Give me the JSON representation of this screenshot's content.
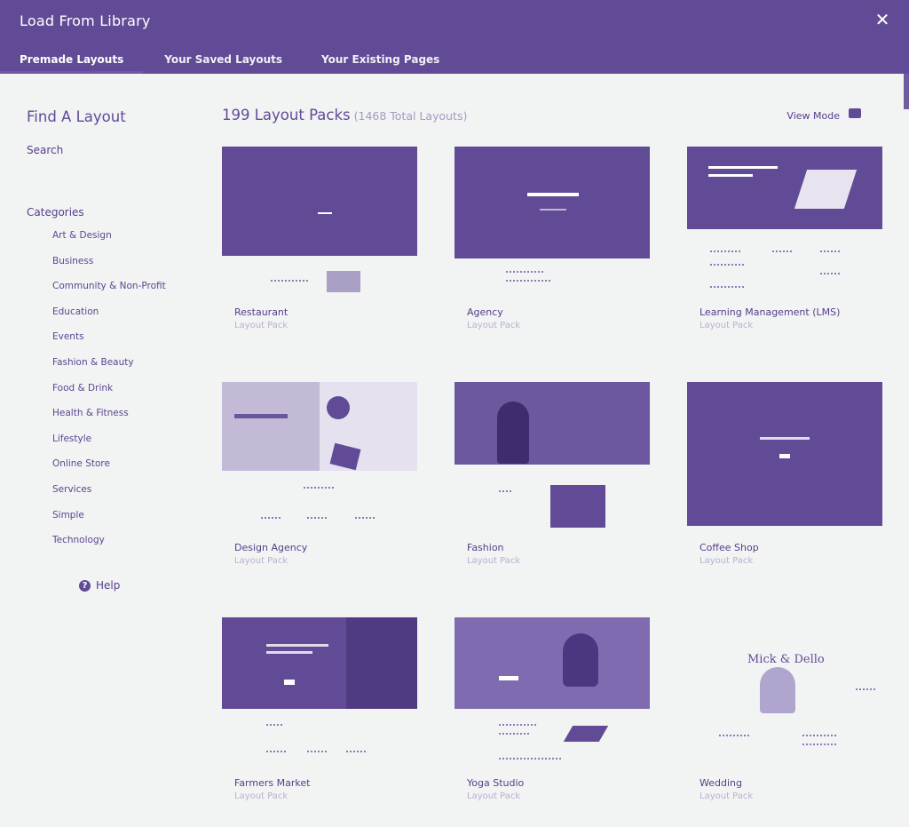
{
  "window": {
    "title": "Load From Library",
    "close_glyph": "✕"
  },
  "tabs": [
    {
      "label": "Premade Layouts",
      "active": true
    },
    {
      "label": "Your Saved Layouts",
      "active": false
    },
    {
      "label": "Your Existing Pages",
      "active": false
    }
  ],
  "sidebar": {
    "title": "Find A Layout",
    "search_label": "Search",
    "categories_label": "Categories",
    "categories": [
      "Art & Design",
      "Business",
      "Community & Non-Profit",
      "Education",
      "Events",
      "Fashion & Beauty",
      "Food & Drink",
      "Health & Fitness",
      "Lifestyle",
      "Online Store",
      "Services",
      "Simple",
      "Technology"
    ],
    "help_label": "Help"
  },
  "main": {
    "count_label": "199 Layout Packs",
    "total_label": "(1468 Total Layouts)",
    "view_mode_label": "View Mode"
  },
  "layouts": [
    {
      "name": "Restaurant",
      "type": "Layout Pack"
    },
    {
      "name": "Agency",
      "type": "Layout Pack"
    },
    {
      "name": "Learning Management (LMS)",
      "type": "Layout Pack"
    },
    {
      "name": "Design Agency",
      "type": "Layout Pack"
    },
    {
      "name": "Fashion",
      "type": "Layout Pack"
    },
    {
      "name": "Coffee Shop",
      "type": "Layout Pack"
    },
    {
      "name": "Farmers Market",
      "type": "Layout Pack"
    },
    {
      "name": "Yoga Studio",
      "type": "Layout Pack"
    },
    {
      "name": "Wedding",
      "type": "Layout Pack",
      "thumb_title": "Mick & Dello"
    }
  ],
  "colors": {
    "accent": "#614b97",
    "background": "#f2f3f3"
  }
}
